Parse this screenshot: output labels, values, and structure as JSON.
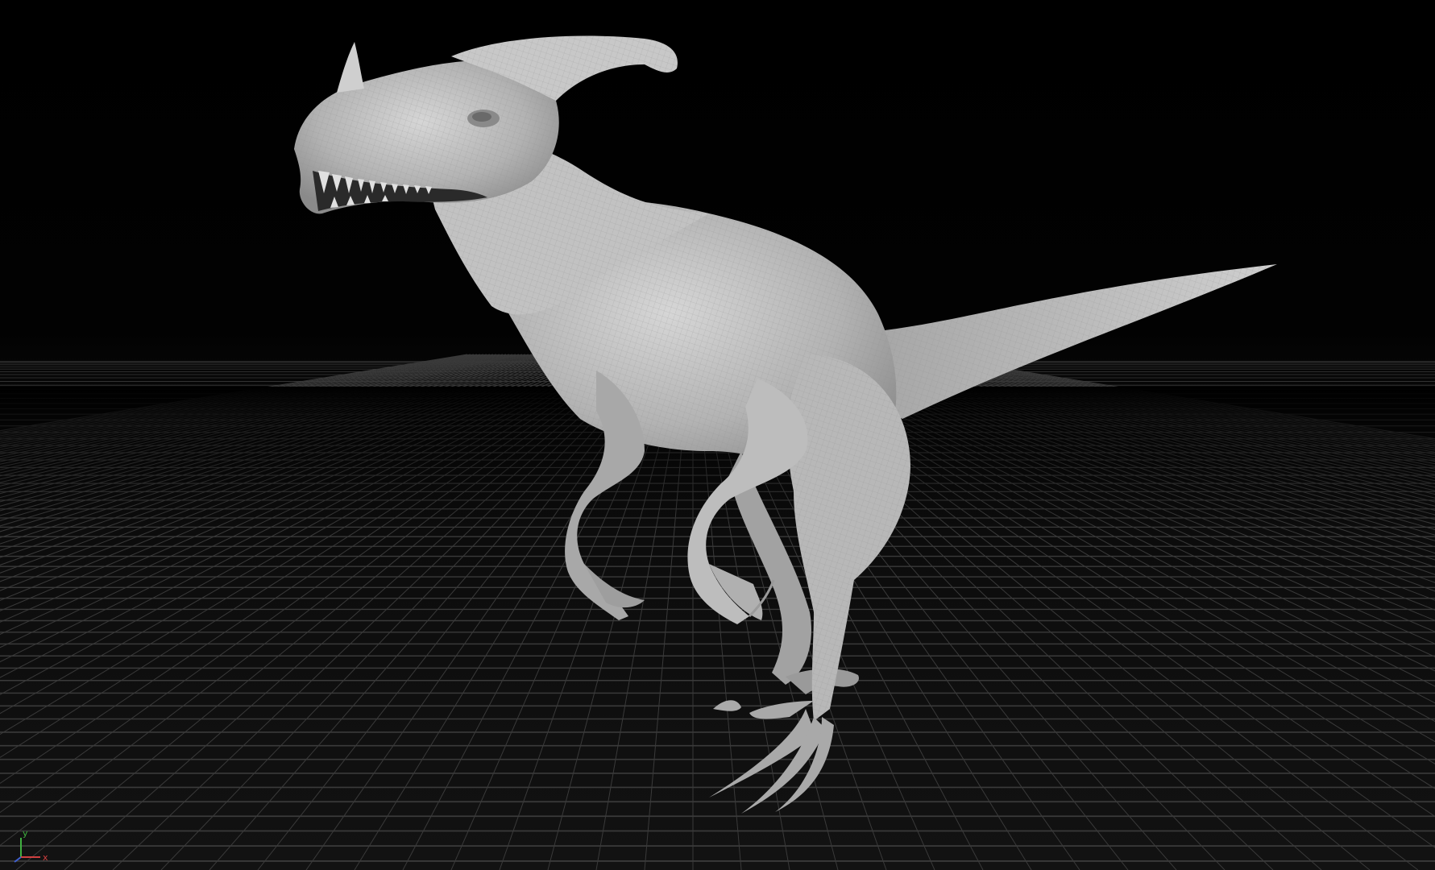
{
  "viewport": {
    "background_color": "#000000",
    "grid_color": "#3a3a3a",
    "model_color": "#b9b9b9",
    "model_shadow_color": "#6e6e6e",
    "model_highlight_color": "#d8d8d8"
  },
  "model": {
    "subject": "raptor-creature",
    "shading": "wireframe-on-shaded"
  },
  "axis_gizmo": {
    "x_label": "x",
    "y_label": "y",
    "x_color": "#d04040",
    "y_color": "#40b040",
    "z_color": "#4060d0"
  }
}
